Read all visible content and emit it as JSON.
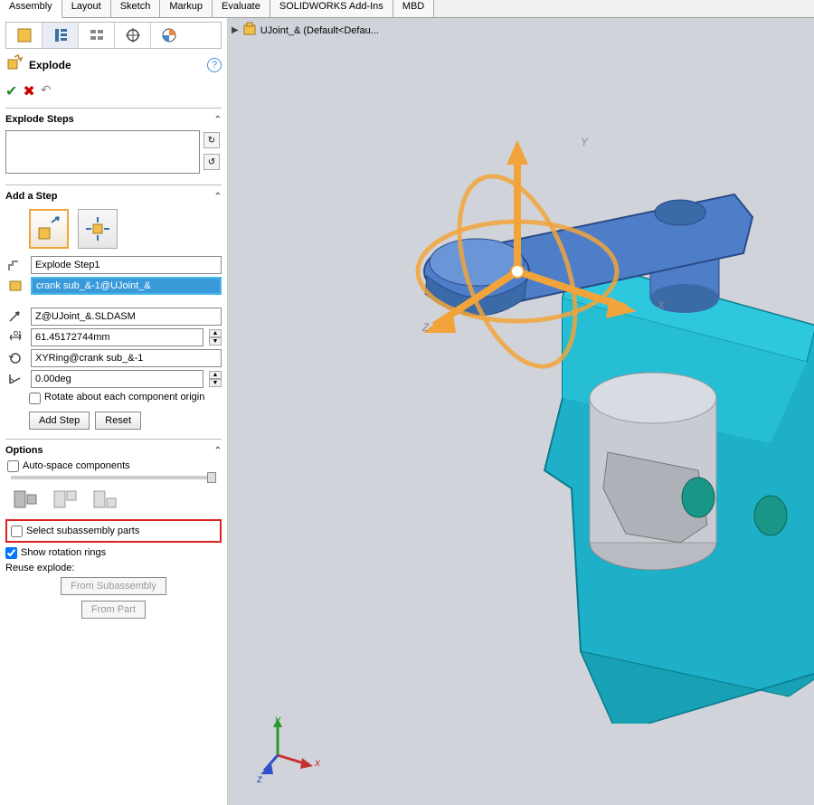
{
  "tabs": [
    "Assembly",
    "Layout",
    "Sketch",
    "Markup",
    "Evaluate",
    "SOLIDWORKS Add-Ins",
    "MBD"
  ],
  "active_tab": "Assembly",
  "breadcrumb": {
    "label": "UJoint_& (Default<Defau..."
  },
  "panel": {
    "feature_title": "Explode",
    "explode_steps": {
      "title": "Explode Steps"
    },
    "add_step": {
      "title": "Add a Step",
      "step_name": "Explode Step1",
      "component": "crank sub_&-1@UJoint_&",
      "axis": "Z@UJoint_&.SLDASM",
      "distance": "61.45172744mm",
      "ring": "XYRing@crank sub_&-1",
      "angle": "0.00deg",
      "rotate_origin": "Rotate about each component origin",
      "add_btn": "Add Step",
      "reset_btn": "Reset"
    },
    "options": {
      "title": "Options",
      "auto_space": "Auto-space components",
      "select_subassembly": "Select subassembly parts",
      "show_rings": "Show rotation rings",
      "reuse_label": "Reuse explode:",
      "from_sub": "From Subassembly",
      "from_part": "From Part"
    }
  },
  "viewport": {
    "axis_labels": {
      "x": "X",
      "y": "Y",
      "z": "Z"
    },
    "triad_labels": {
      "x": "x",
      "y": "y",
      "z": "z"
    }
  },
  "colors": {
    "accent_orange": "#f2a33a",
    "highlight_red": "#d22222",
    "sel_blue": "#3a9ad9",
    "model_teal": "#1eb0c8",
    "model_blue": "#4e7ec8"
  }
}
